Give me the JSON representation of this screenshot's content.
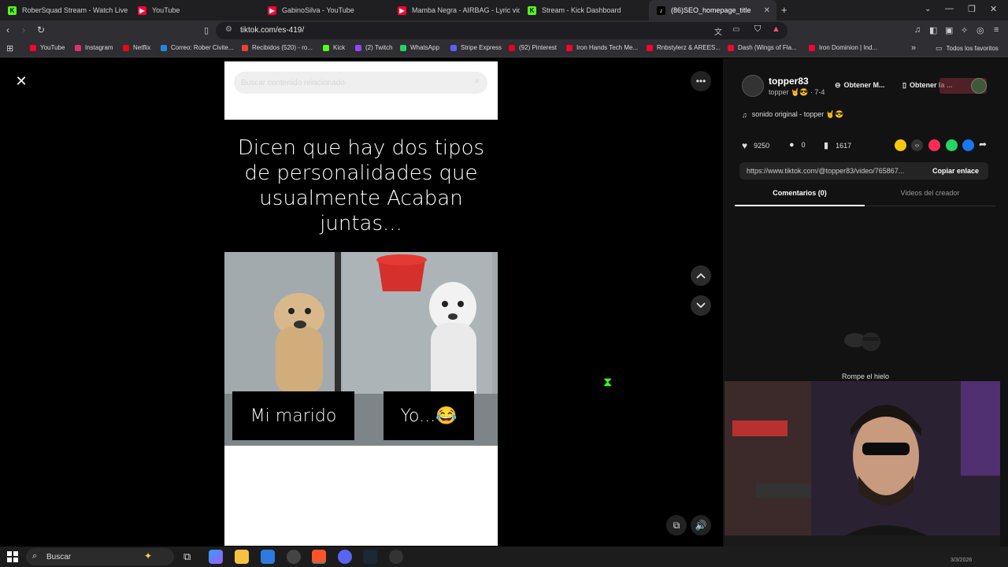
{
  "browser": {
    "tabs": [
      {
        "title": "RoberSquad Stream - Watch Live",
        "color": "#53fc18",
        "glyph": "K"
      },
      {
        "title": "YouTube",
        "color": "#ff0033",
        "glyph": "▶"
      },
      {
        "title": "GabinoSilva - YouTube",
        "color": "#ff0033",
        "glyph": "▶"
      },
      {
        "title": "Mamba Negra - AIRBAG - Lyric video",
        "color": "#ff0033",
        "glyph": "▶"
      },
      {
        "title": "Stream - Kick Dashboard",
        "color": "#53fc18",
        "glyph": "K"
      },
      {
        "title": "(86)SEO_homepage_title",
        "color": "#ffffff",
        "glyph": "♪"
      }
    ],
    "new_tab": "+",
    "url": "tiktok.com/es-419/",
    "bookmarks": [
      {
        "label": "YouTube",
        "color": "#ff0033"
      },
      {
        "label": "Instagram",
        "color": "#e1306c"
      },
      {
        "label": "Netflix",
        "color": "#e50914"
      },
      {
        "label": "Correo: Rober Civite...",
        "color": "#1e88e5"
      },
      {
        "label": "Recibidos (520) - ro...",
        "color": "#ea4335"
      },
      {
        "label": "Kick",
        "color": "#53fc18"
      },
      {
        "label": "(2) Twitch",
        "color": "#9146ff"
      },
      {
        "label": "WhatsApp",
        "color": "#25d366"
      },
      {
        "label": "Stripe Express",
        "color": "#635bff"
      },
      {
        "label": "(92) Pinterest",
        "color": "#e60023"
      },
      {
        "label": "Iron Hands Tech Me...",
        "color": "#ff0033"
      },
      {
        "label": "Rnbstylerz & AREES...",
        "color": "#ff0033"
      },
      {
        "label": "Dash (Wings of Fla...",
        "color": "#ff0033"
      },
      {
        "label": "Iron Dominion | Ind...",
        "color": "#ff0033"
      }
    ],
    "all_bookmarks": "Todos los favoritos"
  },
  "video": {
    "search_placeholder": "Buscar contenido relacionado",
    "caption": "Dicen que hay dos tipos de personalidades que usualmente Acaban juntas...",
    "label_left": "Mi marido",
    "label_right": "Yo...😂"
  },
  "side": {
    "username": "topper83",
    "subtitle": "topper 🤘😎 · 7-4",
    "btn_points": "Obtener M...",
    "btn_app": "Obtener la ...",
    "sound": "sonido original - topper 🤘😎",
    "likes": "9250",
    "comments": "0",
    "saves": "1617",
    "link": "https://www.tiktok.com/@topper83/video/765867...",
    "copy_link": "Copiar enlace",
    "tab_comments": "Comentarios (0)",
    "tab_creator": "Videos del creador",
    "empty_text": "Rompe el hielo"
  },
  "taskbar": {
    "search": "Buscar",
    "date": "3/3/2026"
  }
}
